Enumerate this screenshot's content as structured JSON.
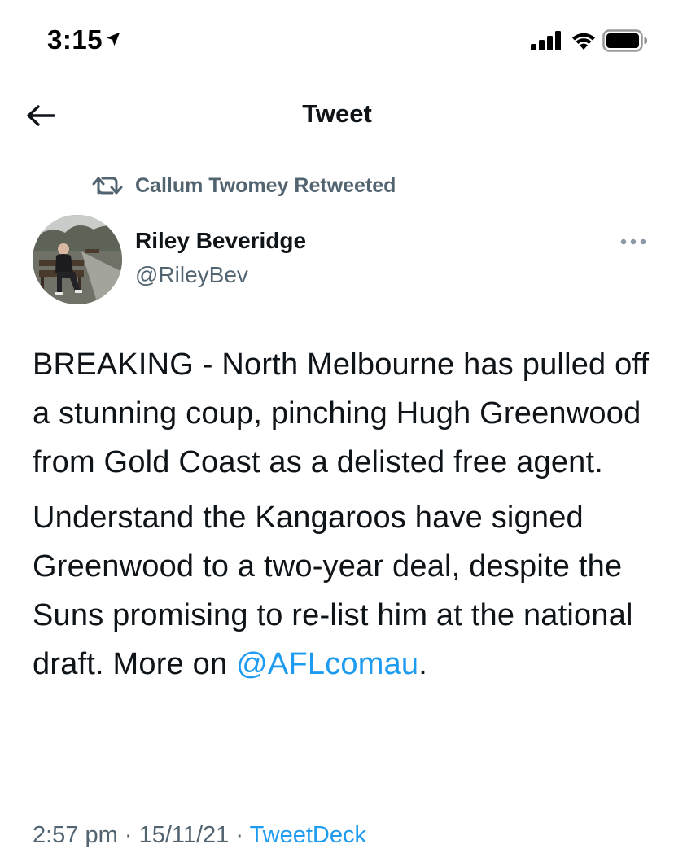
{
  "status_bar": {
    "time": "3:15"
  },
  "header": {
    "title": "Tweet"
  },
  "retweet": {
    "text": "Callum Twomey Retweeted"
  },
  "author": {
    "name": "Riley Beveridge",
    "handle": "@RileyBev"
  },
  "tweet": {
    "paragraph_1": "BREAKING - North Melbourne has pulled off a stunning coup, pinching Hugh Greenwood from Gold Coast as a delisted free agent.",
    "paragraph_2_text": "Understand the Kangaroos have signed Greenwood to a two-year deal, despite the Suns promising to re-list him at the national draft. More on ",
    "mention": "@AFLcomau",
    "paragraph_2_end": "."
  },
  "meta": {
    "time": "2:57 pm",
    "separator_1": " · ",
    "date": "15/11/21",
    "separator_2": " · ",
    "source": "TweetDeck"
  },
  "colors": {
    "link": "#1d9bf0",
    "secondary_text": "#536471",
    "primary_text": "#0f1419"
  },
  "icons": {
    "back": "arrow-left-icon",
    "retweet": "retweet-icon",
    "more": "more-dots-icon",
    "location": "location-arrow-icon",
    "signal": "cellular-signal-icon",
    "wifi": "wifi-icon",
    "battery": "battery-icon"
  }
}
